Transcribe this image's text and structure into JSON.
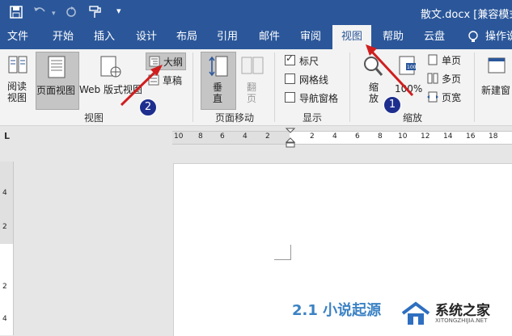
{
  "titlebar": {
    "title": "散文.docx [兼容模式]",
    "save_icon": "save-icon",
    "undo_icon": "undo-icon",
    "redo_icon": "redo-icon",
    "format_painter_icon": "format-painter-icon",
    "customize_icon": "customize-quick-access-icon"
  },
  "tabs": [
    "文件",
    "开始",
    "插入",
    "设计",
    "布局",
    "引用",
    "邮件",
    "审阅",
    "视图",
    "帮助",
    "云盘"
  ],
  "active_tab": "视图",
  "tell_me": "操作说",
  "ribbon": {
    "views": {
      "read_mode": "阅读\n视图",
      "print_layout": "页面视图",
      "web_layout": "Web 版式视图",
      "outline": "大纲",
      "draft": "草稿",
      "group_label": "视图"
    },
    "page_movement": {
      "vertical": "垂\n直",
      "side_to_side": "翻\n页",
      "group_label": "页面移动"
    },
    "show": {
      "ruler": "标尺",
      "ruler_checked": true,
      "gridlines": "网格线",
      "gridlines_checked": false,
      "nav_pane": "导航窗格",
      "nav_pane_checked": false,
      "group_label": "显示"
    },
    "zoom": {
      "zoom": "缩\n放",
      "hundred": "100%",
      "one_page": "单页",
      "multiple_pages": "多页",
      "page_width": "页宽",
      "group_label": "缩放"
    },
    "window": {
      "new_window": "新建窗"
    }
  },
  "ruler": {
    "h_ticks": [
      "10",
      "8",
      "6",
      "4",
      "2",
      "",
      "2",
      "4",
      "6",
      "8",
      "10",
      "12",
      "14",
      "16",
      "18"
    ],
    "v_ticks": [
      "4",
      "2",
      "2",
      "4"
    ],
    "corner": "L"
  },
  "document": {
    "heading": "2.1 小说起源"
  },
  "annotations": {
    "badge1": "1",
    "badge2": "2"
  },
  "watermark": {
    "brand": "系统之家",
    "url": "XITONGZHIJIA.NET"
  },
  "colors": {
    "accent": "#2b579a",
    "arrow": "#d01e1e",
    "badge": "#1e2e8e",
    "heading": "#3b82c4"
  }
}
